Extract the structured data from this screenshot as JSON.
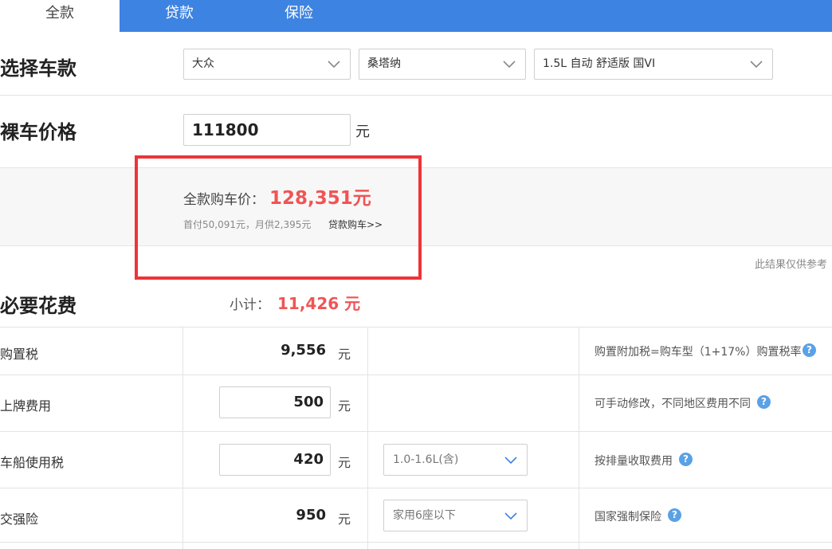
{
  "tabs": [
    {
      "label": "全款",
      "active": true
    },
    {
      "label": "贷款",
      "active": false
    },
    {
      "label": "保险",
      "active": false
    }
  ],
  "select_car": {
    "title": "选择车款",
    "brand": "大众",
    "model": "桑塔纳",
    "trim": "1.5L 自动 舒适版 国VI"
  },
  "bare_price": {
    "title": "裸车价格",
    "value": "111800",
    "unit": "元"
  },
  "result": {
    "total_label": "全款购车价：",
    "total_value": "128,351元",
    "sub_line": "首付50,091元，月供2,395元",
    "loan_link": "贷款购车>>",
    "note": "此结果仅供参考"
  },
  "necessary": {
    "title": "必要花费",
    "subtotal_label": "小计：",
    "subtotal_value": "11,426 元",
    "rows": [
      {
        "label": "购置税",
        "value": "9,556",
        "unit": "元",
        "note": "购置附加税=购车型（1+17%）购置税率"
      },
      {
        "label": "上牌费用",
        "value": "500",
        "unit": "元",
        "note": "可手动修改，不同地区费用不同"
      },
      {
        "label": "车船使用税",
        "value": "420",
        "unit": "元",
        "option": "1.0-1.6L(含)",
        "note": "按排量收取费用"
      },
      {
        "label": "交强险",
        "value": "950",
        "unit": "元",
        "option": "家用6座以下",
        "note": "国家强制保险"
      }
    ]
  },
  "help_glyph": "?",
  "colors": {
    "tab_bar": "#3d83e1",
    "accent_red": "#f05455",
    "highlight_border": "#ee3438",
    "help_icon": "#5aa1e6"
  }
}
